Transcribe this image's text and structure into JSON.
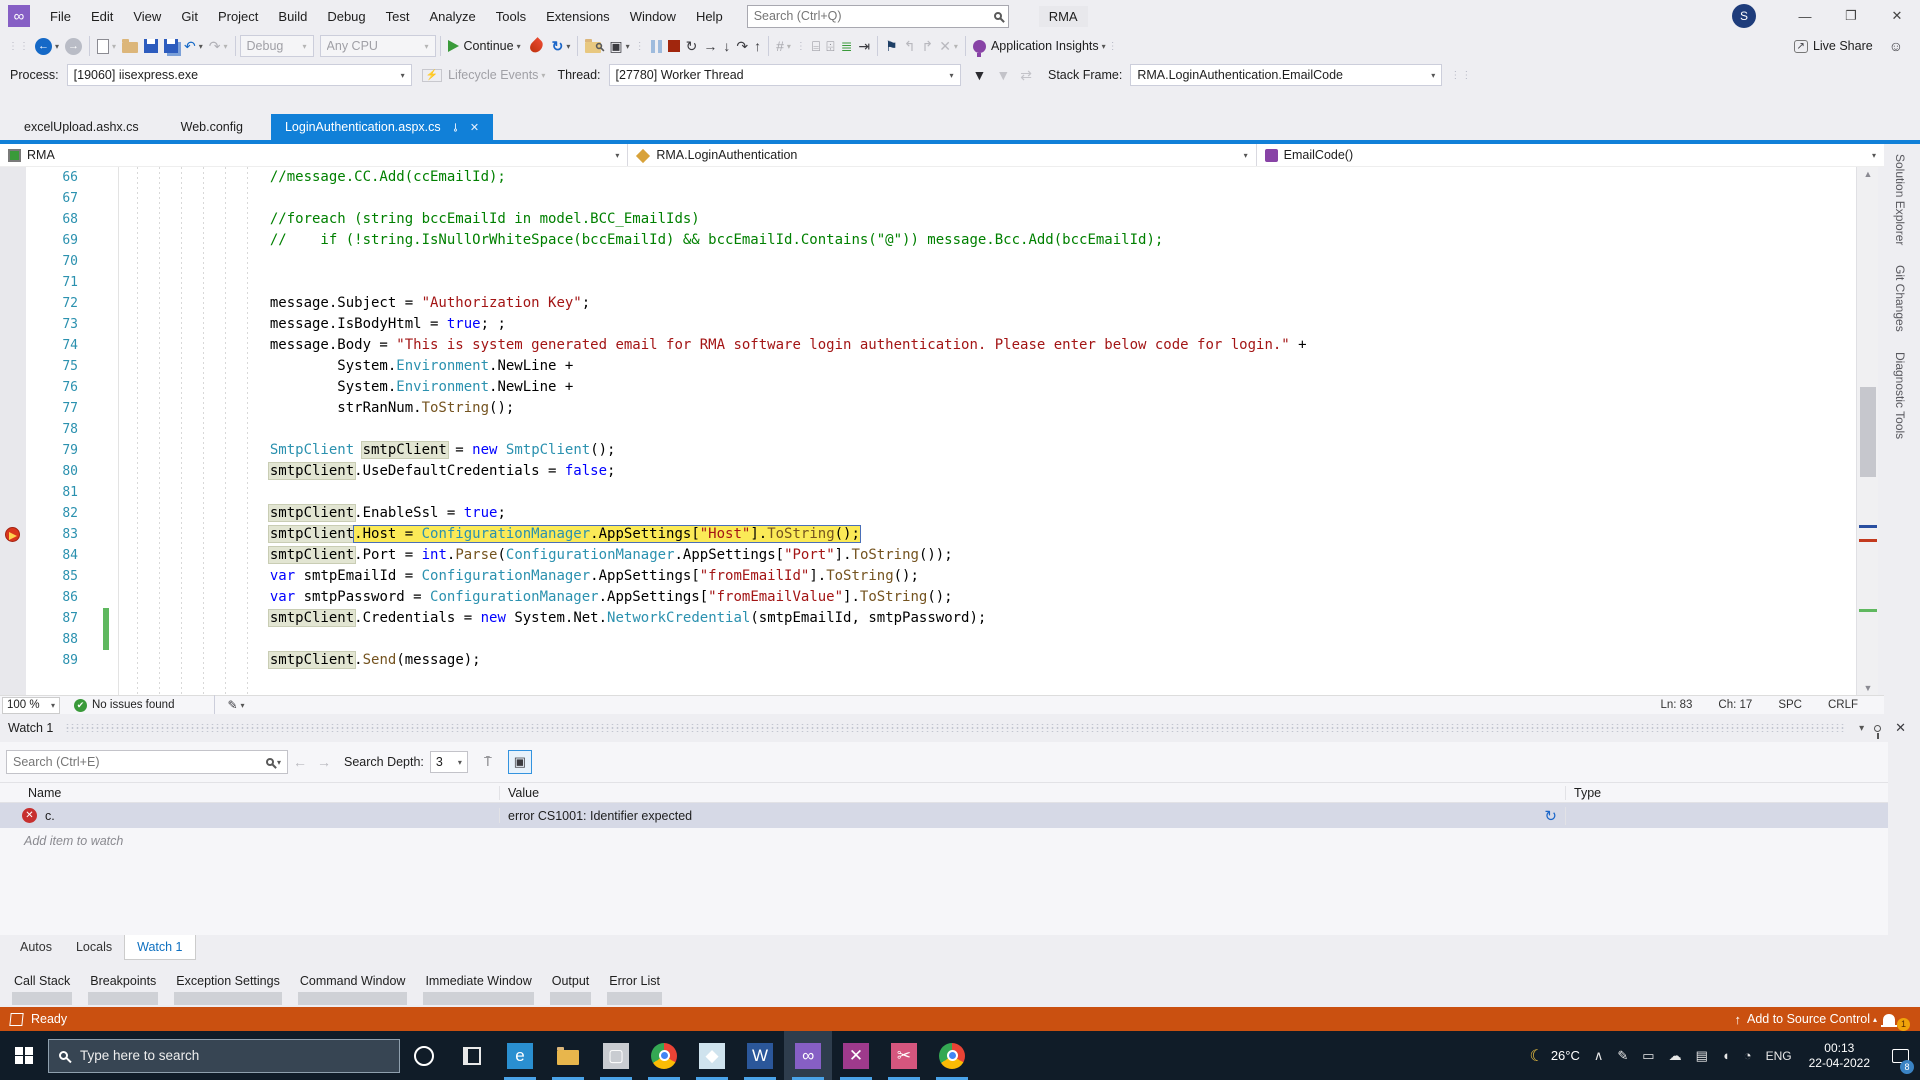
{
  "titlebar": {
    "menus": [
      "File",
      "Edit",
      "View",
      "Git",
      "Project",
      "Build",
      "Debug",
      "Test",
      "Analyze",
      "Tools",
      "Extensions",
      "Window",
      "Help"
    ],
    "search_placeholder": "Search (Ctrl+Q)",
    "solution": "RMA",
    "avatar_initial": "S",
    "minimize": "—",
    "restore": "❐",
    "close": "✕"
  },
  "toolbar": {
    "debug_config": "Debug",
    "platform": "Any CPU",
    "continue_label": "Continue",
    "app_insights": "Application Insights",
    "live_share": "Live Share"
  },
  "process_bar": {
    "process_label": "Process:",
    "process_value": "[19060] iisexpress.exe",
    "lifecycle": "Lifecycle Events",
    "thread_label": "Thread:",
    "thread_value": "[27780] Worker Thread",
    "stack_frame_label": "Stack Frame:",
    "stack_frame_value": "RMA.LoginAuthentication.EmailCode"
  },
  "tabs": [
    {
      "label": "excelUpload.ashx.cs",
      "active": false
    },
    {
      "label": "Web.config",
      "active": false
    },
    {
      "label": "LoginAuthentication.aspx.cs",
      "active": true
    }
  ],
  "navbar": {
    "project": "RMA",
    "type": "RMA.LoginAuthentication",
    "member": "EmailCode()"
  },
  "editor": {
    "lines": [
      {
        "n": 66,
        "seg": [
          [
            "cm",
            "                //message.CC.Add(ccEmailId);"
          ]
        ]
      },
      {
        "n": 67,
        "seg": []
      },
      {
        "n": 68,
        "seg": [
          [
            "cm",
            "                //foreach (string bccEmailId in model.BCC_EmailIds)"
          ]
        ]
      },
      {
        "n": 69,
        "seg": [
          [
            "cm",
            "                //    if (!string.IsNullOrWhiteSpace(bccEmailId) && bccEmailId.Contains(\"@\")) message.Bcc.Add(bccEmailId);"
          ]
        ]
      },
      {
        "n": 70,
        "seg": []
      },
      {
        "n": 71,
        "seg": []
      },
      {
        "n": 72,
        "seg": [
          [
            "pl",
            "                message.Subject = "
          ],
          [
            "st",
            "\"Authorization Key\""
          ],
          [
            "pl",
            ";"
          ]
        ]
      },
      {
        "n": 73,
        "seg": [
          [
            "pl",
            "                message.IsBodyHtml = "
          ],
          [
            "kw",
            "true"
          ],
          [
            "pl",
            "; ;"
          ]
        ]
      },
      {
        "n": 74,
        "seg": [
          [
            "pl",
            "                message.Body = "
          ],
          [
            "st",
            "\"This is system generated email for RMA software login authentication. Please enter below code for login.\""
          ],
          [
            "pl",
            " +"
          ]
        ]
      },
      {
        "n": 75,
        "seg": [
          [
            "pl",
            "                        System."
          ],
          [
            "ty",
            "Environment"
          ],
          [
            "pl",
            ".NewLine +"
          ]
        ]
      },
      {
        "n": 76,
        "seg": [
          [
            "pl",
            "                        System."
          ],
          [
            "ty",
            "Environment"
          ],
          [
            "pl",
            ".NewLine +"
          ]
        ]
      },
      {
        "n": 77,
        "seg": [
          [
            "pl",
            "                        strRanNum."
          ],
          [
            "me",
            "ToString"
          ],
          [
            "pl",
            "();"
          ]
        ]
      },
      {
        "n": 78,
        "seg": []
      },
      {
        "n": 79,
        "seg": [
          [
            "ty",
            "                SmtpClient "
          ],
          [
            "box",
            "smtpClient"
          ],
          [
            "pl",
            " = "
          ],
          [
            "kw",
            "new"
          ],
          [
            "pl",
            " "
          ],
          [
            "ty",
            "SmtpClient"
          ],
          [
            "pl",
            "();"
          ]
        ]
      },
      {
        "n": 80,
        "seg": [
          [
            "pl",
            "                "
          ],
          [
            "box",
            "smtpClient"
          ],
          [
            "pl",
            ".UseDefaultCredentials = "
          ],
          [
            "kw",
            "false"
          ],
          [
            "pl",
            ";"
          ]
        ]
      },
      {
        "n": 81,
        "seg": []
      },
      {
        "n": 82,
        "seg": [
          [
            "pl",
            "                "
          ],
          [
            "box",
            "smtpClient"
          ],
          [
            "pl",
            ".EnableSsl = "
          ],
          [
            "kw",
            "true"
          ],
          [
            "pl",
            ";"
          ]
        ]
      },
      {
        "n": 83,
        "bp": true,
        "curFrom": 2,
        "seg": [
          [
            "pl",
            "                "
          ],
          [
            "box",
            "smtpClient"
          ],
          [
            "pl",
            ".Host = "
          ],
          [
            "ty",
            "ConfigurationManager"
          ],
          [
            "pl",
            ".AppSettings["
          ],
          [
            "st",
            "\"Host\""
          ],
          [
            "pl",
            "]."
          ],
          [
            "me",
            "ToString"
          ],
          [
            "pl",
            "();"
          ]
        ]
      },
      {
        "n": 84,
        "seg": [
          [
            "pl",
            "                "
          ],
          [
            "box",
            "smtpClient"
          ],
          [
            "pl",
            ".Port = "
          ],
          [
            "kw",
            "int"
          ],
          [
            "pl",
            "."
          ],
          [
            "me",
            "Parse"
          ],
          [
            "pl",
            "("
          ],
          [
            "ty",
            "ConfigurationManager"
          ],
          [
            "pl",
            ".AppSettings["
          ],
          [
            "st",
            "\"Port\""
          ],
          [
            "pl",
            "]."
          ],
          [
            "me",
            "ToString"
          ],
          [
            "pl",
            "());"
          ]
        ]
      },
      {
        "n": 85,
        "seg": [
          [
            "pl",
            "                "
          ],
          [
            "kw",
            "var"
          ],
          [
            "pl",
            " smtpEmailId = "
          ],
          [
            "ty",
            "ConfigurationManager"
          ],
          [
            "pl",
            ".AppSettings["
          ],
          [
            "st",
            "\"fromEmailId\""
          ],
          [
            "pl",
            "]."
          ],
          [
            "me",
            "ToString"
          ],
          [
            "pl",
            "();"
          ]
        ]
      },
      {
        "n": 86,
        "seg": [
          [
            "pl",
            "                "
          ],
          [
            "kw",
            "var"
          ],
          [
            "pl",
            " smtpPassword = "
          ],
          [
            "ty",
            "ConfigurationManager"
          ],
          [
            "pl",
            ".AppSettings["
          ],
          [
            "st",
            "\"fromEmailValue\""
          ],
          [
            "pl",
            "]."
          ],
          [
            "me",
            "ToString"
          ],
          [
            "pl",
            "();"
          ]
        ]
      },
      {
        "n": 87,
        "chg": true,
        "seg": [
          [
            "pl",
            "                "
          ],
          [
            "box",
            "smtpClient"
          ],
          [
            "pl",
            ".Credentials = "
          ],
          [
            "kw",
            "new"
          ],
          [
            "pl",
            " System.Net."
          ],
          [
            "ty",
            "NetworkCredential"
          ],
          [
            "pl",
            "(smtpEmailId, smtpPassword);"
          ]
        ]
      },
      {
        "n": 88,
        "chg": true,
        "seg": []
      },
      {
        "n": 89,
        "seg": [
          [
            "pl",
            "                "
          ],
          [
            "box",
            "smtpClient"
          ],
          [
            "pl",
            "."
          ],
          [
            "me",
            "Send"
          ],
          [
            "pl",
            "(message);"
          ]
        ]
      }
    ]
  },
  "editor_status": {
    "zoom": "100 %",
    "issues": "No issues found",
    "ln": "Ln: 83",
    "ch": "Ch: 17",
    "spc": "SPC",
    "eol": "CRLF"
  },
  "side_tabs": [
    "Solution Explorer",
    "Git Changes",
    "Diagnostic Tools"
  ],
  "watch": {
    "title": "Watch 1",
    "search_placeholder": "Search (Ctrl+E)",
    "depth_label": "Search Depth:",
    "depth_value": "3",
    "columns": [
      "Name",
      "Value",
      "Type"
    ],
    "rows": [
      {
        "name": "c.",
        "value": "error CS1001: Identifier expected",
        "type": ""
      }
    ],
    "add_hint": "Add item to watch",
    "tabs": [
      "Autos",
      "Locals",
      "Watch 1"
    ],
    "active_tab": "Watch 1"
  },
  "bottom_tabs": [
    "Call Stack",
    "Breakpoints",
    "Exception Settings",
    "Command Window",
    "Immediate Window",
    "Output",
    "Error List"
  ],
  "status_bar": {
    "ready": "Ready",
    "source_control": "Add to Source Control",
    "badge": "1"
  },
  "taskbar": {
    "search_placeholder": "Type here to search",
    "apps": [
      {
        "name": "app-icon-edge",
        "glyph": "e",
        "bg": "#2a8fd0",
        "running": true
      },
      {
        "name": "app-icon-file-explorer",
        "glyph": "folder",
        "bg": "#e8b64c",
        "running": true
      },
      {
        "name": "app-icon-generic",
        "glyph": "▢",
        "bg": "#c9ccd1",
        "running": true
      },
      {
        "name": "app-icon-chrome",
        "glyph": "chrome",
        "bg": "",
        "running": true
      },
      {
        "name": "app-icon-light",
        "glyph": "◆",
        "bg": "#cfe3ee",
        "running": true
      },
      {
        "name": "app-icon-word",
        "glyph": "W",
        "bg": "#2b579a",
        "running": true
      },
      {
        "name": "app-icon-visual-studio",
        "glyph": "∞",
        "bg": "#865fc5",
        "running": true,
        "active": true
      },
      {
        "name": "app-icon-purple",
        "glyph": "✕",
        "bg": "#9e3a8c",
        "running": true
      },
      {
        "name": "app-icon-scissors",
        "glyph": "✂",
        "bg": "#d5567e",
        "running": true
      },
      {
        "name": "app-icon-chrome-2",
        "glyph": "chrome",
        "bg": "",
        "running": true
      }
    ],
    "temp": "26°C",
    "lang": "ENG",
    "time": "00:13",
    "date": "22-04-2022",
    "badge": "8"
  },
  "colors": {
    "accent_blue": "#1180d8",
    "debug_orange": "#ca5010",
    "breakpoint_red": "#d8361c",
    "current_statement_yellow": "#fbea57",
    "taskbar_dark": "#101c28"
  }
}
